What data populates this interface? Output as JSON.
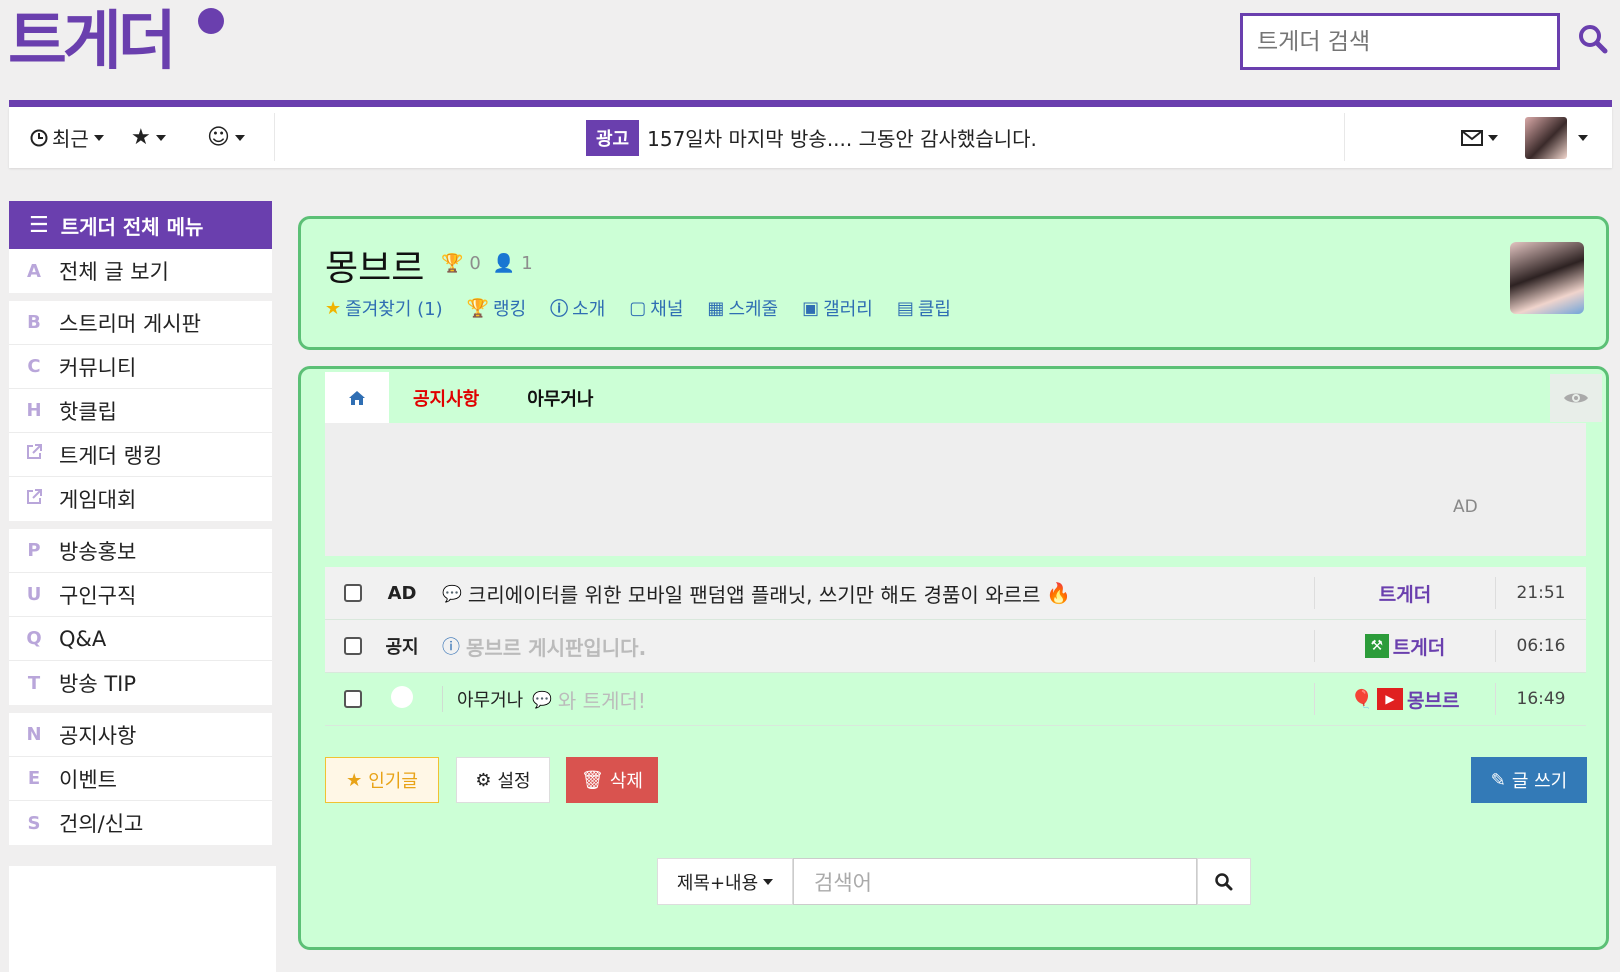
{
  "header": {
    "logo": "트게더",
    "search_placeholder": "트게더 검색"
  },
  "navbar": {
    "recent_label": "최근",
    "ad_badge": "광고",
    "ad_text": "157일차 마지막 방송.... 그동안 감사했습니다."
  },
  "sidebar": {
    "title": "트게더 전체 메뉴",
    "groups": [
      [
        {
          "key": "A",
          "label": "전체 글 보기"
        }
      ],
      [
        {
          "key": "B",
          "label": "스트리머 게시판"
        },
        {
          "key": "C",
          "label": "커뮤니티"
        },
        {
          "key": "H",
          "label": "핫클립"
        },
        {
          "key": "external-link-icon",
          "label": "트게더 랭킹"
        },
        {
          "key": "external-link-icon",
          "label": "게임대회"
        }
      ],
      [
        {
          "key": "P",
          "label": "방송홍보"
        },
        {
          "key": "U",
          "label": "구인구직"
        },
        {
          "key": "Q",
          "label": "Q&A"
        },
        {
          "key": "T",
          "label": "방송 TIP"
        }
      ],
      [
        {
          "key": "N",
          "label": "공지사항"
        },
        {
          "key": "E",
          "label": "이벤트"
        },
        {
          "key": "S",
          "label": "건의/신고"
        }
      ]
    ]
  },
  "channel": {
    "name": "몽브르",
    "trophies": "0",
    "members": "1",
    "links": [
      "즐겨찾기 (1)",
      "랭킹",
      "소개",
      "채널",
      "스케줄",
      "갤러리",
      "클립"
    ]
  },
  "board": {
    "tabs": [
      "공지사항",
      "아무거나"
    ],
    "ad_label": "AD",
    "posts": [
      {
        "tag": "AD",
        "category": "",
        "title": "크리에이터를 위한 모바일 팬덤앱 플래닛, 쓰기만 해도 경품이 와르르",
        "author": "트게더",
        "time": "21:51"
      },
      {
        "tag": "공지",
        "category": "",
        "title": "몽브르 게시판입니다.",
        "author": "트게더",
        "time": "06:16"
      },
      {
        "tag": "",
        "category": "아무거나",
        "title": "와 트게더!",
        "author": "몽브르",
        "time": "16:49"
      }
    ],
    "buttons": {
      "popular": "인기글",
      "settings": "설정",
      "delete": "삭제",
      "write": "글 쓰기"
    },
    "search": {
      "scope": "제목+내용",
      "placeholder": "검색어"
    }
  },
  "colors": {
    "brand": "#6a3fae",
    "board_bg": "#ccffd6",
    "board_border": "#5cc076",
    "link": "#2f6eb3",
    "danger": "#d9534f",
    "primary": "#337ab7"
  }
}
